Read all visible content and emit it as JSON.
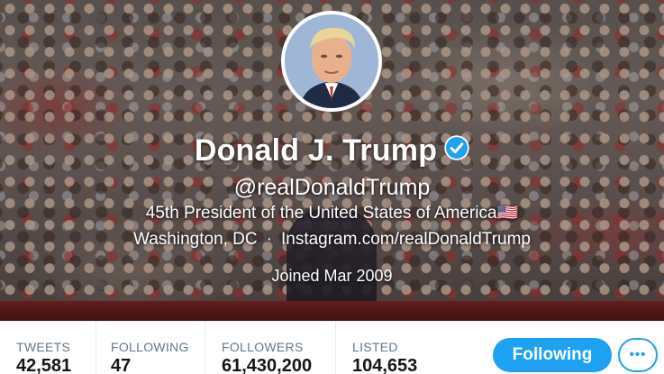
{
  "profile": {
    "name": "Donald J. Trump",
    "handle": "@realDonaldTrump",
    "bio": "45th President of the United States of America",
    "bio_flag": "🇺🇸",
    "location": "Washington, DC",
    "separator": "·",
    "website": "Instagram.com/realDonaldTrump",
    "joined": "Joined Mar 2009",
    "verified": true
  },
  "stats": [
    {
      "label": "TWEETS",
      "value": "42,581"
    },
    {
      "label": "FOLLOWING",
      "value": "47"
    },
    {
      "label": "FOLLOWERS",
      "value": "61,430,200"
    },
    {
      "label": "LISTED",
      "value": "104,653"
    }
  ],
  "actions": {
    "follow_label": "Following",
    "more_label": "•••"
  },
  "colors": {
    "accent": "#1da1f2",
    "label_gray": "#657786",
    "value_dark": "#14171a"
  },
  "icons": {
    "verified": "verified-badge-icon",
    "more": "more-options-icon"
  }
}
